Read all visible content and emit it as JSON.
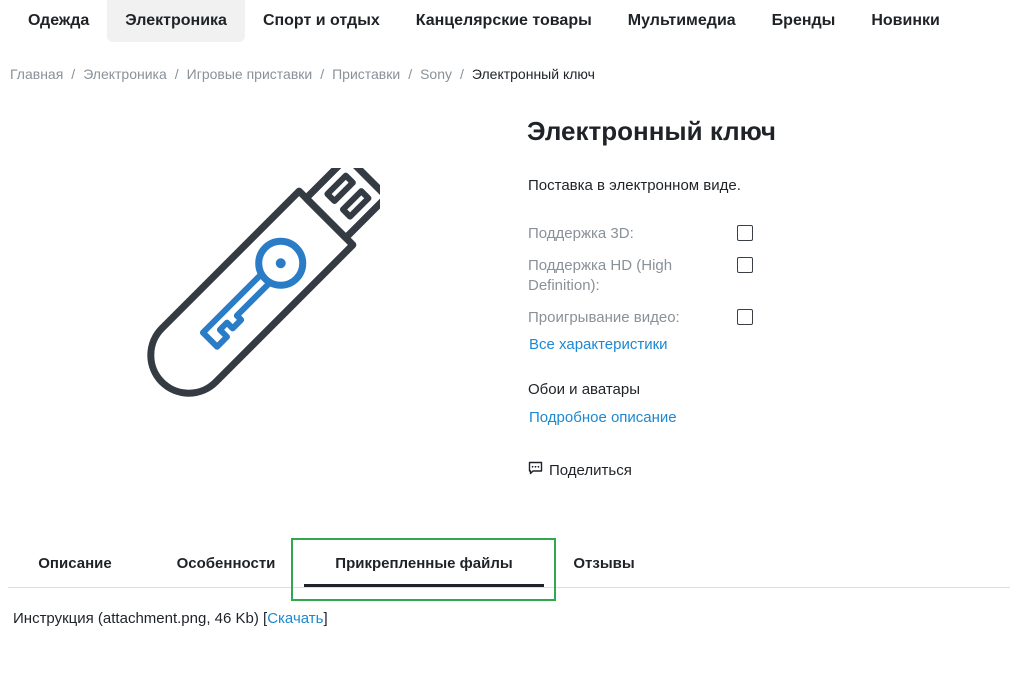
{
  "nav": {
    "items": [
      "Одежда",
      "Электроника",
      "Спорт и отдых",
      "Канцелярские товары",
      "Мультимедиа",
      "Бренды",
      "Новинки"
    ]
  },
  "breadcrumb": {
    "items": [
      "Главная",
      "Электроника",
      "Игровые приставки",
      "Приставки",
      "Sony"
    ],
    "current": "Электронный ключ"
  },
  "product": {
    "title": "Электронный ключ",
    "delivery": "Поставка в электронном виде.",
    "features": [
      {
        "label": "Поддержка 3D:",
        "checked": false
      },
      {
        "label": "Поддержка HD (High Definition):",
        "checked": false
      },
      {
        "label": "Проигрывание видео:",
        "checked": false
      }
    ],
    "all_specs_link": "Все характеристики",
    "wallpapers": "Обои и аватары",
    "details_link": "Подробное описание",
    "share_label": "Поделиться"
  },
  "tabs": {
    "items": [
      "Описание",
      "Особенности",
      "Прикрепленные файлы",
      "Отзывы"
    ],
    "active": "Прикрепленные файлы"
  },
  "attachment": {
    "text": "Инструкция (attachment.png, 46 Kb)",
    "bracket_open": "[",
    "download": "Скачать",
    "bracket_close": "]"
  },
  "colors": {
    "accent_link": "#1e88d0",
    "icon_blue": "#2a7cc7",
    "icon_dark": "#353b43",
    "highlight": "#2fa84f"
  },
  "icons": {
    "product": "usb-key-icon",
    "share": "share-chat-icon"
  }
}
